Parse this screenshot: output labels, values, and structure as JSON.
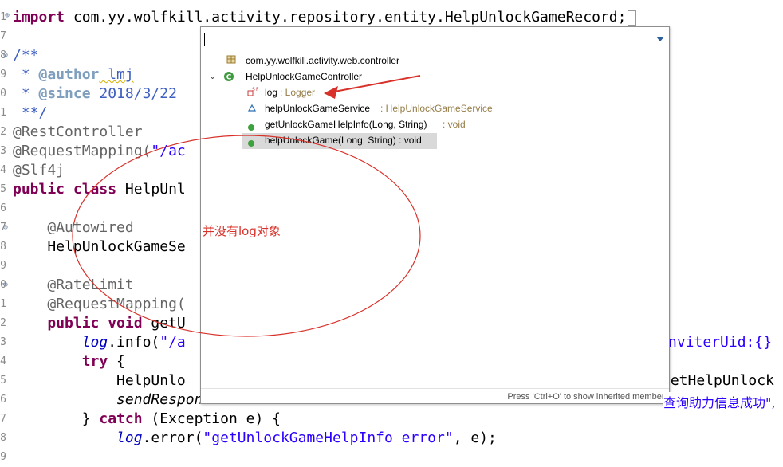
{
  "editor": {
    "line_numbers": [
      "1",
      "7",
      "8",
      "9",
      "0",
      "1",
      "2",
      "3",
      "4",
      "5",
      "6",
      "7",
      "8",
      "9",
      "0",
      "1",
      "2",
      "3",
      "4",
      "5",
      "6",
      "7",
      "8",
      "9"
    ],
    "lines": {
      "import_kw": "import",
      "import_path": " com.yy.wolfkill.activity.repository.entity.HelpUnlockGameRecord;",
      "doc_open": "/**",
      "author_tag": "@author",
      "author_val": " lmj",
      "since_tag": "@since",
      "since_val": " 2018/3/22",
      "doc_close": "**/",
      "rest_controller": "@RestController",
      "request_mapping_1": "@RequestMapping(",
      "request_mapping_1_str": "\"/ac",
      "slf4j": "@Slf4j",
      "class_kw": "public class",
      "class_name": " HelpUnl",
      "autowired": "@Autowired",
      "service_field": "HelpUnlockGameSe",
      "rate_limit": "@RateLimit",
      "request_mapping_2": "@RequestMapping(",
      "method_kw": "public void",
      "method_name": " getU",
      "method_tail": "){",
      "log_info": "log",
      "log_info_rest": ".info(",
      "log_info_str": "\"/a",
      "log_info_tail": "nviterUid:{}",
      "try_kw": "try",
      "try_brace": " {",
      "helpunl": "HelpUnlo",
      "helpunl_tail": "getHelpUnlock",
      "send_response": "sendRespon",
      "catch_pre": "} ",
      "catch_kw": "catch",
      "catch_rest": " (Exception e) {",
      "log_error": "log",
      "log_error_rest": ".error(",
      "log_error_str": "\"getUnlockGameHelpInfo error\"",
      "log_error_tail": ", e);",
      "success_cn": "查询助力信息成功\","
    }
  },
  "outline": {
    "filter_value": "",
    "items": [
      {
        "icon": "package-icon",
        "label": "com.yy.wolfkill.activity.web.controller",
        "type": ""
      },
      {
        "icon": "class-icon",
        "label": "HelpUnlockGameController",
        "type": ""
      },
      {
        "icon": "static-final-field-icon",
        "label": "log",
        "type": " : Logger"
      },
      {
        "icon": "default-field-icon",
        "label": "helpUnlockGameService",
        "type": " : HelpUnlockGameService"
      },
      {
        "icon": "public-method-icon",
        "label": "getUnlockGameHelpInfo(Long, String)",
        "type": " : void"
      },
      {
        "icon": "public-method-icon",
        "label": "helpUnlockGame(Long, String) : void",
        "type": ""
      }
    ],
    "status_hint": "Press 'Ctrl+O' to show inherited members"
  },
  "annotation": {
    "note": "并没有log对象",
    "color": "#d8312a"
  },
  "colors": {
    "keyword": "#7f0055",
    "annotation": "#646464",
    "string": "#2a00ff",
    "javadoc": "#3f5fbf",
    "field": "#0000c0"
  }
}
